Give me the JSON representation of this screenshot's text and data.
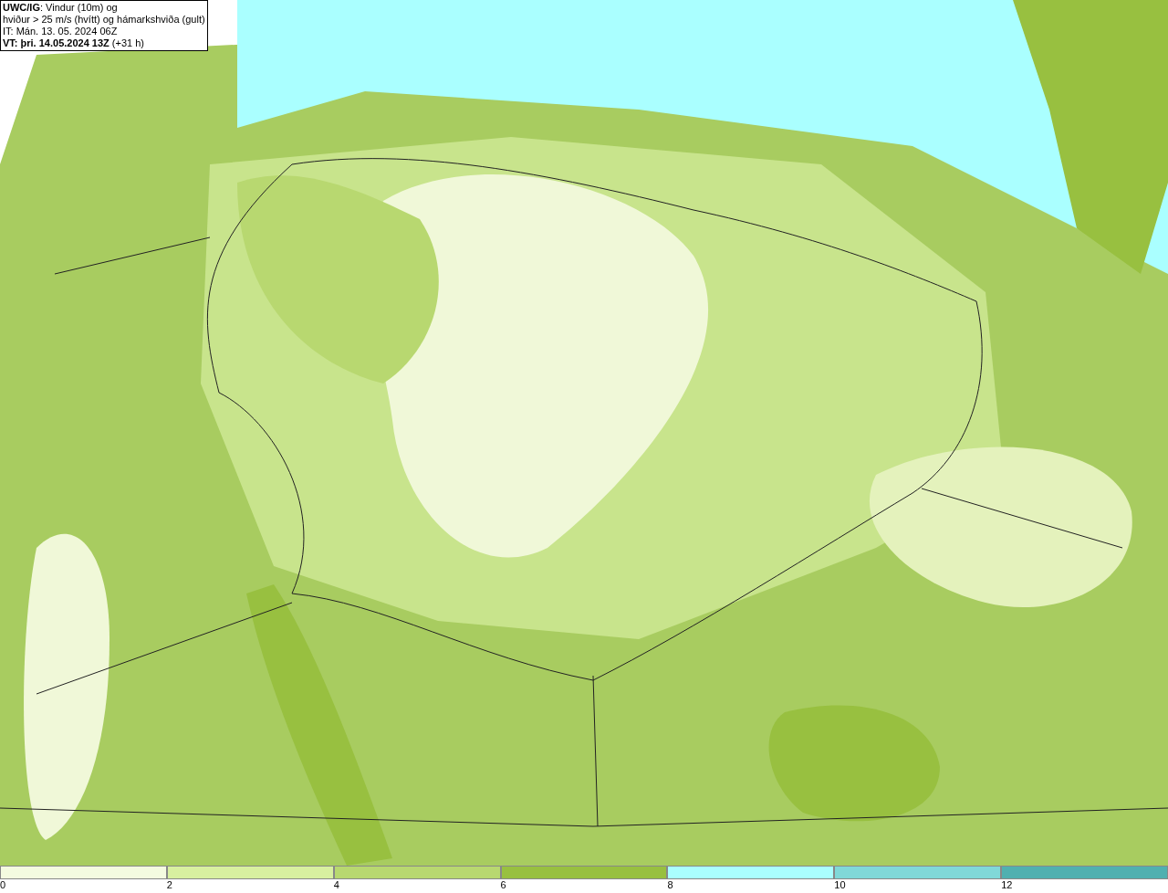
{
  "title_box": {
    "lines": [
      "**UWC/IG**: Vindur (10m) og",
      "hviður > 25 m/s (hvítt) og hámarkshviða (gult)",
      "IT: Mán. 13. 05. 2024 06Z",
      "**VT: þri. 14.05.2024 13Z** (+31 h)"
    ]
  },
  "legend": {
    "segments": [
      {
        "label": "0",
        "color": "#f4fbe0"
      },
      {
        "label": "2",
        "color": "#d8f0a0"
      },
      {
        "label": "4",
        "color": "#b8d870"
      },
      {
        "label": "6",
        "color": "#98c040"
      },
      {
        "label": "8",
        "color": "#aaffff"
      },
      {
        "label": "10",
        "color": "#80d8d8"
      },
      {
        "label": "12",
        "color": "#50b0b0"
      }
    ]
  }
}
